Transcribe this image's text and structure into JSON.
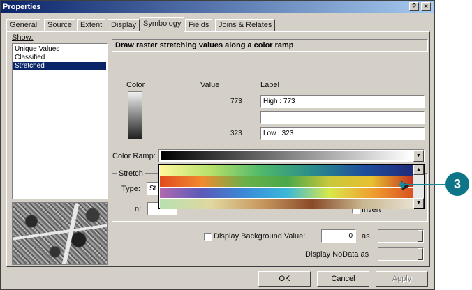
{
  "window": {
    "title": "Properties",
    "help_btn": "?",
    "close_btn": "×"
  },
  "tabs": [
    "General",
    "Source",
    "Extent",
    "Display",
    "Symbology",
    "Fields",
    "Joins & Relates"
  ],
  "active_tab": "Symbology",
  "show": {
    "label": "Show:",
    "items": [
      "Unique Values",
      "Classified",
      "Stretched"
    ],
    "selected": "Stretched"
  },
  "header": "Draw raster stretching values along a color ramp",
  "columns": {
    "color": "Color",
    "value": "Value",
    "label": "Label"
  },
  "high": {
    "value": "773",
    "label": "High : 773"
  },
  "middle_label": "",
  "low": {
    "value": "323",
    "label": "Low : 323"
  },
  "color_ramp": {
    "label": "Color Ramp:",
    "selected": "black-to-white",
    "options": [
      "yellow-green-blue",
      "orange-green-yellow-red",
      "multi-hue-purple-blue-yellow-orange",
      "pastel-green-brown"
    ]
  },
  "stretch": {
    "group_label": "Stretch",
    "type_label": "Type:",
    "type_value": "St",
    "n_label": "n:",
    "invert_label": "Invert"
  },
  "background": {
    "label": "Display Background Value:",
    "value": "0",
    "as_label": "as"
  },
  "nodata": {
    "label": "Display NoData as"
  },
  "buttons": {
    "ok": "OK",
    "cancel": "Cancel",
    "apply": "Apply"
  },
  "callout": {
    "number": "3"
  },
  "colors": {
    "titlebar": "#0a246a",
    "selection": "#0a246a",
    "callout": "#0e7487"
  }
}
